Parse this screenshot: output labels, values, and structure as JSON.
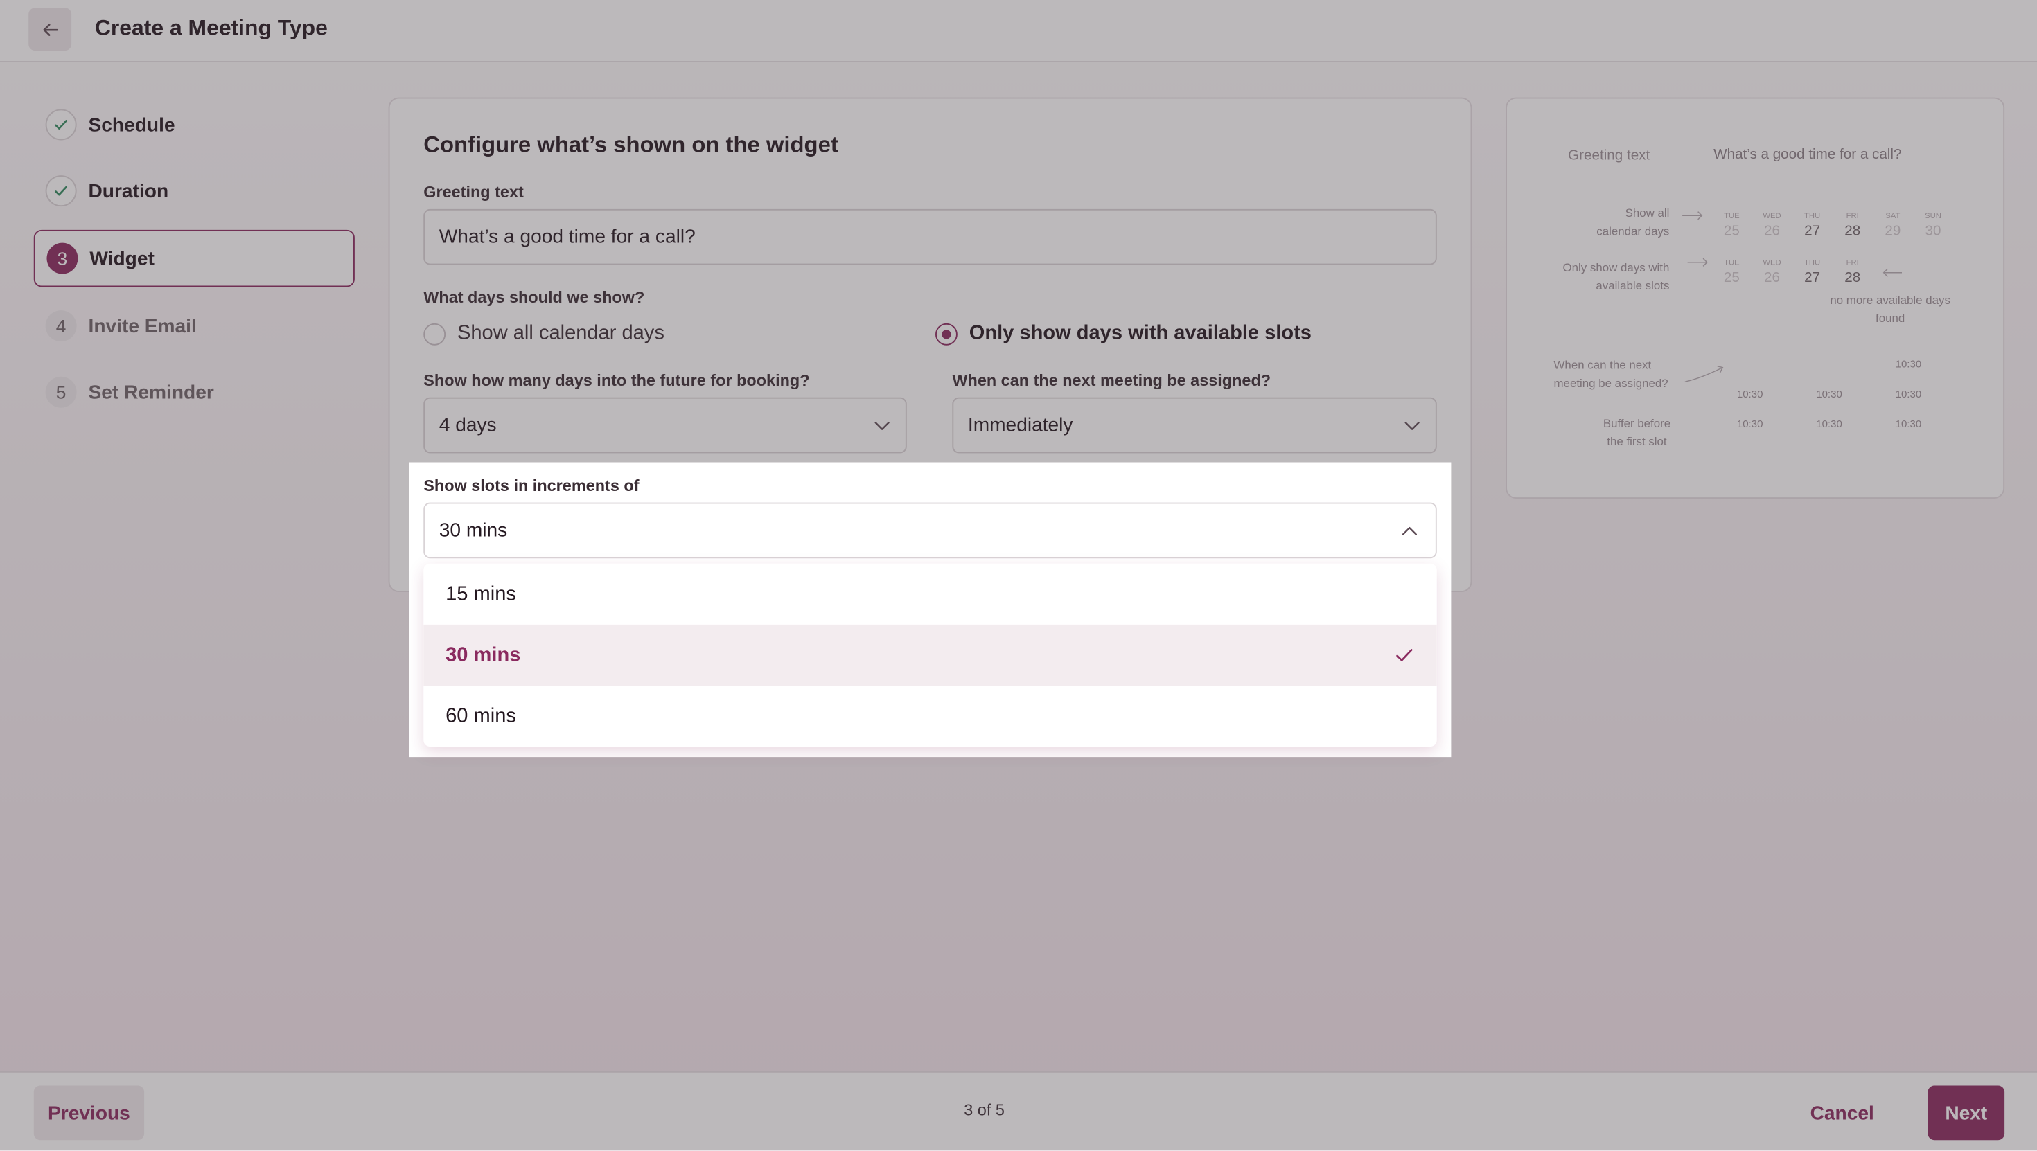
{
  "header": {
    "title": "Create a Meeting Type",
    "back_icon": "arrow-left-icon"
  },
  "steps": [
    {
      "number": "1",
      "label": "Schedule",
      "state": "done"
    },
    {
      "number": "2",
      "label": "Duration",
      "state": "done"
    },
    {
      "number": "3",
      "label": "Widget",
      "state": "active"
    },
    {
      "number": "4",
      "label": "Invite Email",
      "state": "todo"
    },
    {
      "number": "5",
      "label": "Set Reminder",
      "state": "todo"
    }
  ],
  "form": {
    "title": "Configure what’s shown on the widget",
    "greeting_label": "Greeting text",
    "greeting_value": "What’s a good time for a call?",
    "days_question": "What days should we show?",
    "radio_all": "Show all calendar days",
    "radio_available": "Only show days with available slots",
    "selected_radio": "Only show days with available slots",
    "future_label": "Show how many days into the future for booking?",
    "future_value": "4 days",
    "next_label": "When can the next meeting be assigned?",
    "next_value": "Immediately",
    "increments_label": "Show slots in increments of",
    "increments_value": "30 mins",
    "increments_options": [
      "15 mins",
      "30 mins",
      "60 mins"
    ]
  },
  "preview": {
    "greeting_label": "Greeting text",
    "greeting_value": "What’s a good time for a call?",
    "show_all_line1": "Show all",
    "show_all_line2": "calendar days",
    "only_line1": "Only show days with",
    "only_line2": "available slots",
    "no_more_line1": "no more available days",
    "no_more_line2": "found",
    "next_line1": "When can the next",
    "next_line2": "meeting be assigned?",
    "buffer_line1": "Buffer before",
    "buffer_line2": "the first slot",
    "row1": [
      {
        "dow": "TUE",
        "date": "25"
      },
      {
        "dow": "WED",
        "date": "26"
      },
      {
        "dow": "THU",
        "date": "27"
      },
      {
        "dow": "FRI",
        "date": "28"
      },
      {
        "dow": "SAT",
        "date": "29"
      },
      {
        "dow": "SUN",
        "date": "30"
      }
    ],
    "row2": [
      {
        "dow": "TUE",
        "date": "25"
      },
      {
        "dow": "WED",
        "date": "26"
      },
      {
        "dow": "THU",
        "date": "27"
      },
      {
        "dow": "FRI",
        "date": "28"
      }
    ],
    "slot": "10:30"
  },
  "footer": {
    "previous": "Previous",
    "page": "3 of 5",
    "cancel": "Cancel",
    "next": "Next"
  },
  "colors": {
    "brand": "#8a2a5f",
    "overlay": "rgba(70,60,66,0.36)"
  }
}
